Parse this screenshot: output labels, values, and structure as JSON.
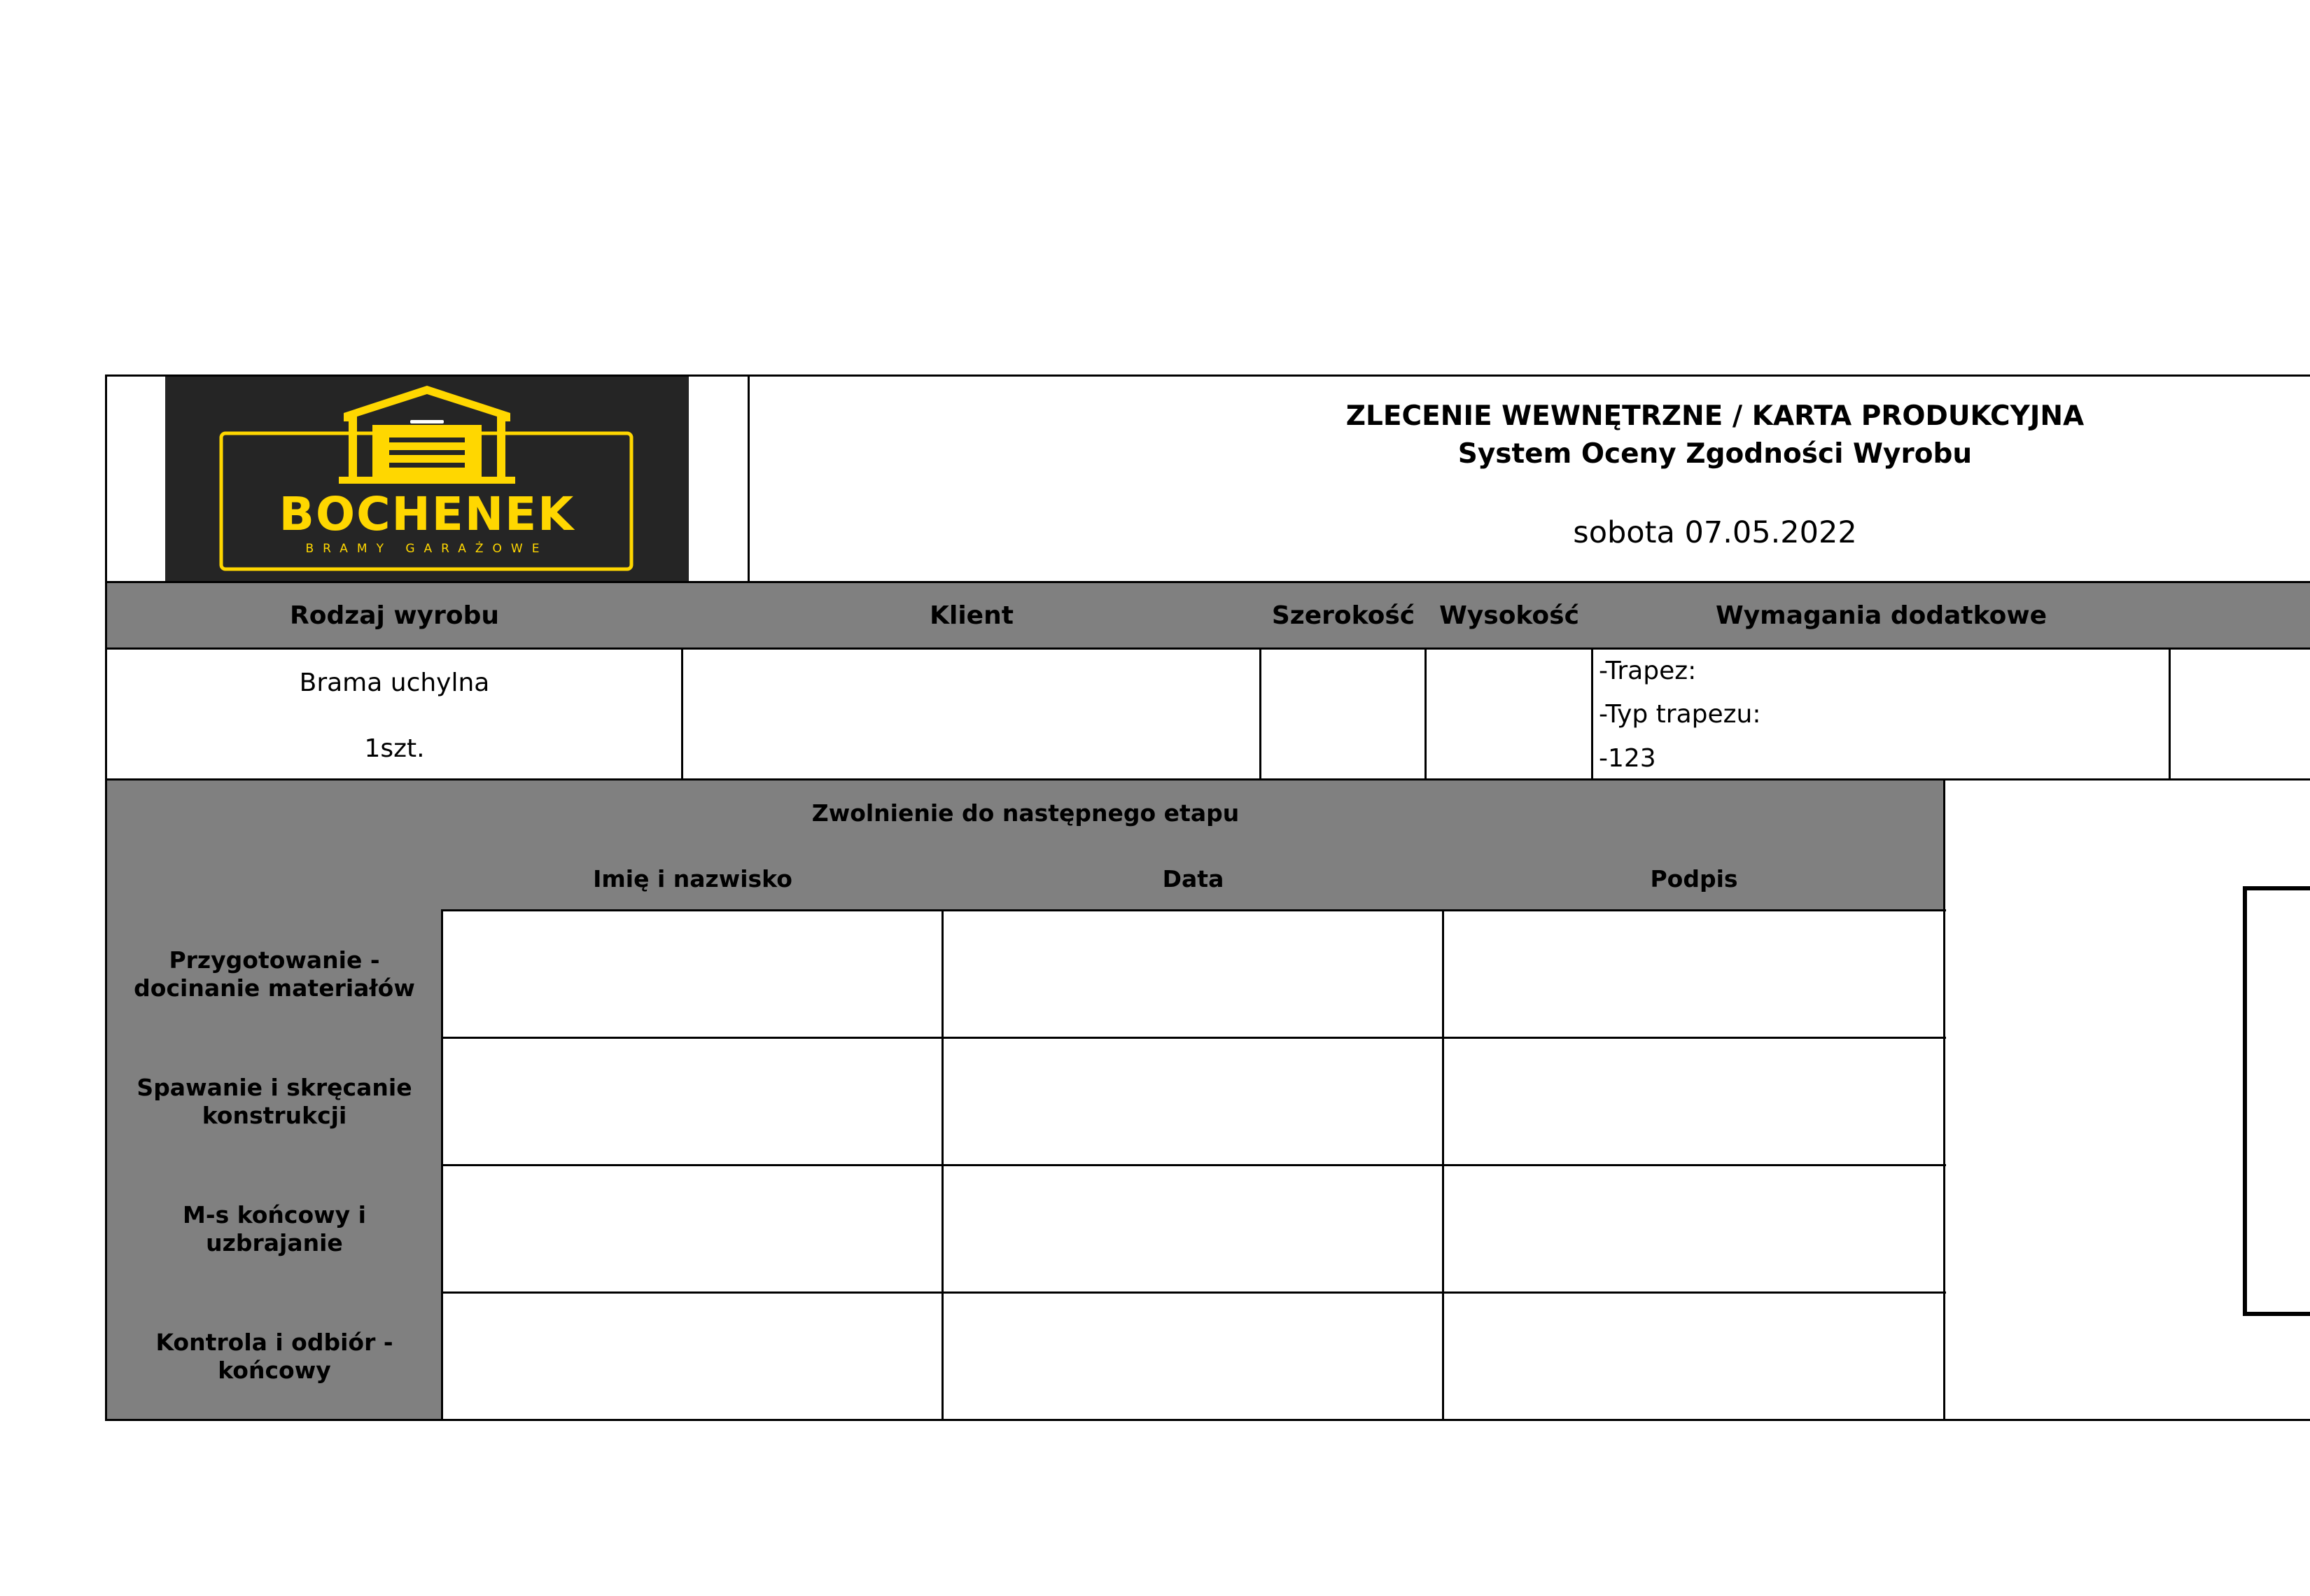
{
  "header": {
    "logo": {
      "brand": "BOCHENEK",
      "tagline": "BRAMY GARAŻOWE",
      "accent": "#FFD700",
      "background": "#252525"
    },
    "title": "ZLECENIE WEWNĘTRZNE / KARTA PRODUKCYJNA",
    "subtitle": "System Oceny Zgodności Wyrobu",
    "date": "sobota 07.05.2022"
  },
  "product_table": {
    "headers": {
      "type": "Rodzaj wyrobu",
      "client": "Klient",
      "width": "Szerokość",
      "height": "Wysokość",
      "extra": "Wymagania dodatkowe"
    },
    "row": {
      "type": "Brama uchylna",
      "quantity": "1szt.",
      "client": "",
      "width": "",
      "height": "",
      "extra_lines": [
        "-Trapez:",
        "-Typ trapezu:",
        "-123"
      ]
    }
  },
  "release_table": {
    "title": "Zwolnienie do następnego etapu",
    "columns": [
      "Imię i nazwisko",
      "Data",
      "Podpis"
    ],
    "stages": [
      "Przygotowanie -\ndocinanie materiałów",
      "Spawanie i skręcanie\nkonstrukcji",
      "M-s końcowy i\nuzbrajanie",
      "Kontrola i odbiór -\nkońcowy"
    ]
  },
  "colors": {
    "header_gray": "#808080",
    "border": "#000000"
  }
}
